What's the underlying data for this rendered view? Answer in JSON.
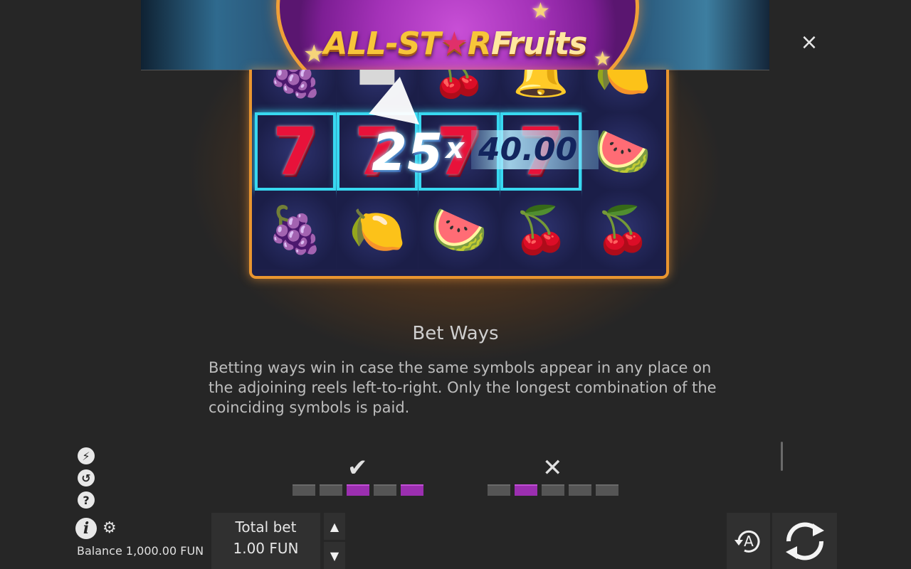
{
  "game": {
    "logo_part1": "ALL-ST",
    "logo_star": "★",
    "logo_part2": "R",
    "logo_part3": "Fruits"
  },
  "reels": {
    "rows": [
      [
        "grapes",
        "bar",
        "cherries",
        "bell",
        "lemon"
      ],
      [
        "seven",
        "seven",
        "seven",
        "seven",
        "watermelon"
      ],
      [
        "grapes",
        "lemon",
        "watermelon",
        "cherries",
        "cherries"
      ]
    ],
    "symbols": {
      "grapes": "🍇",
      "lemon": "🍋",
      "cherries": "🍒",
      "watermelon": "🍉",
      "bell": "🔔",
      "bar": "▬",
      "seven": "7"
    },
    "win_ways": "25",
    "win_multiplier_sign": "x",
    "win_amount": "40.00"
  },
  "help": {
    "title": "Bet Ways",
    "body": "Betting ways win in case the same symbols appear in any place on the adjoining reels left-to-right. Only the longest combination of the coinciding symbols is paid."
  },
  "examples": {
    "valid_mark": "✔",
    "invalid_mark": "✕",
    "valid_segments": [
      false,
      false,
      true,
      false,
      true
    ],
    "invalid_segments": [
      false,
      true,
      false,
      false,
      false
    ]
  },
  "icons": {
    "close": "×",
    "chip": "⚡",
    "history": "↺",
    "help": "?",
    "info": "i",
    "settings": "⚙",
    "bet_up": "▲",
    "bet_down": "▼"
  },
  "footer": {
    "balance": "Balance 1,000.00 FUN",
    "total_bet_label": "Total bet",
    "total_bet_value": "1.00 FUN"
  },
  "colors": {
    "accent_purple": "#9b2fb0",
    "frame_orange": "#e9952f",
    "win_cyan": "#38d8f0"
  }
}
